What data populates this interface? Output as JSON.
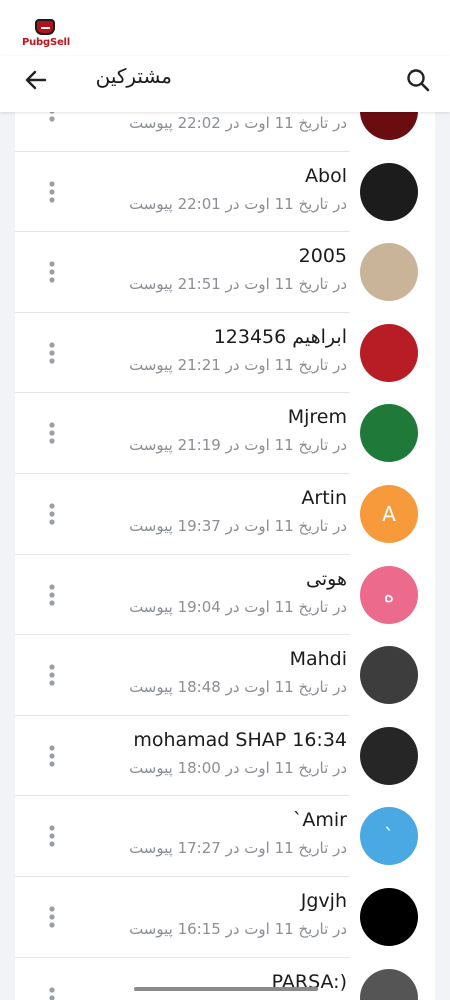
{
  "brand": {
    "logo_text": "PubgSell"
  },
  "header": {
    "title": "مشترکین"
  },
  "colors": {
    "accent_orange": "#f79a3c",
    "accent_pink": "#ec6b8c",
    "accent_blue": "#4aa8e3",
    "subtitle_gray": "#8a8f95"
  },
  "subscribers": [
    {
      "name": "",
      "subtitle": "در تاریخ 11 اوت در 22:02 پیوست",
      "avatar_letter": "",
      "avatar_color": "#6b0d10"
    },
    {
      "name": "Abol",
      "subtitle": "در تاریخ 11 اوت در 22:01 پیوست",
      "avatar_letter": "",
      "avatar_color": "#1c1c1c"
    },
    {
      "name": "2005",
      "subtitle": "در تاریخ 11 اوت در 21:51 پیوست",
      "avatar_letter": "",
      "avatar_color": "#c9b49a"
    },
    {
      "name": "ابراهیم 123456",
      "subtitle": "در تاریخ 11 اوت در 21:21 پیوست",
      "avatar_letter": "",
      "avatar_color": "#b81c24"
    },
    {
      "name": "Mjrem",
      "subtitle": "در تاریخ 11 اوت در 21:19 پیوست",
      "avatar_letter": "",
      "avatar_color": "#1f7a3a"
    },
    {
      "name": "Artin",
      "subtitle": "در تاریخ 11 اوت در 19:37 پیوست",
      "avatar_letter": "A",
      "avatar_color": "#f79a3c"
    },
    {
      "name": "هوتی",
      "subtitle": "در تاریخ 11 اوت در 19:04 پیوست",
      "avatar_letter": "ه",
      "avatar_color": "#ec6b8c"
    },
    {
      "name": "Mahdi",
      "subtitle": "در تاریخ 11 اوت در 18:48 پیوست",
      "avatar_letter": "",
      "avatar_color": "#3d3d3d"
    },
    {
      "name": "mohamad SHAP 16:34",
      "subtitle": "در تاریخ 11 اوت در 18:00 پیوست",
      "avatar_letter": "",
      "avatar_color": "#262626"
    },
    {
      "name": "`Amir",
      "subtitle": "در تاریخ 11 اوت در 17:27 پیوست",
      "avatar_letter": "`",
      "avatar_color": "#4aa8e3"
    },
    {
      "name": "Jgvjh",
      "subtitle": "در تاریخ 11 اوت در 16:15 پیوست",
      "avatar_letter": "",
      "avatar_color": "#000000"
    },
    {
      "name": "PARSA:)",
      "subtitle": "",
      "avatar_letter": "",
      "avatar_color": "#555555"
    }
  ]
}
